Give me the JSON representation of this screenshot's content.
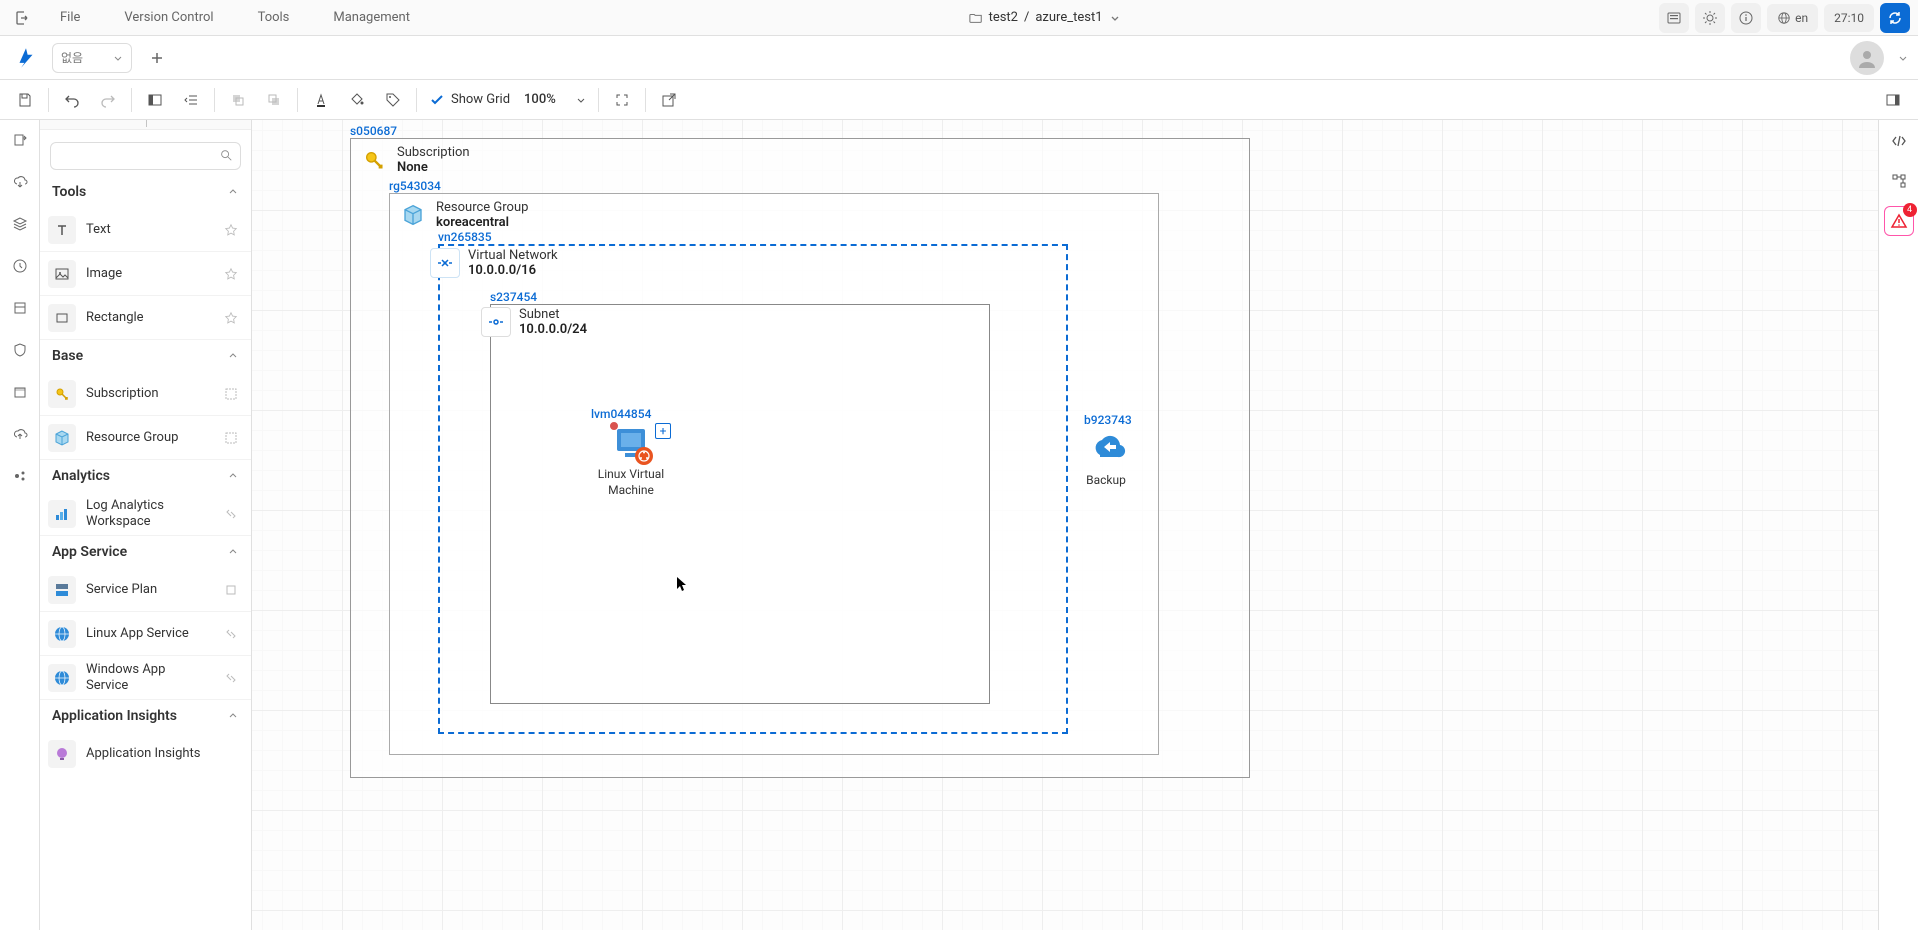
{
  "menu": {
    "file": "File",
    "versionControl": "Version Control",
    "tools": "Tools",
    "management": "Management"
  },
  "breadcrumb": {
    "parent": "test2",
    "current": "azure_test1"
  },
  "top": {
    "lang": "en",
    "time": "27:10"
  },
  "dropdown": {
    "label": "없음"
  },
  "toolbar": {
    "showGrid": "Show Grid",
    "zoom": "100%"
  },
  "sections": {
    "tools": "Tools",
    "base": "Base",
    "analytics": "Analytics",
    "appService": "App Service",
    "appInsights": "Application Insights"
  },
  "items": {
    "text": "Text",
    "image": "Image",
    "rectangle": "Rectangle",
    "subscription": "Subscription",
    "resourceGroup": "Resource Group",
    "logAnalytics": "Log Analytics Workspace",
    "servicePlan": "Service Plan",
    "linuxApp": "Linux App Service",
    "windowsApp": "Windows App Service",
    "appInsights": "Application Insights"
  },
  "canvas": {
    "subscription": {
      "id": "s050687",
      "title": "Subscription",
      "value": "None"
    },
    "resourceGroup": {
      "id": "rg543034",
      "title": "Resource Group",
      "value": "koreacentral"
    },
    "vnet": {
      "id": "vn265835",
      "title": "Virtual Network",
      "value": "10.0.0.0/16"
    },
    "subnet": {
      "id": "s237454",
      "title": "Subnet",
      "value": "10.0.0.0/24"
    },
    "vm": {
      "id": "lvm044854",
      "label": "Linux Virtual Machine"
    },
    "backup": {
      "id": "b923743",
      "label": "Backup"
    }
  },
  "warnCount": "4"
}
